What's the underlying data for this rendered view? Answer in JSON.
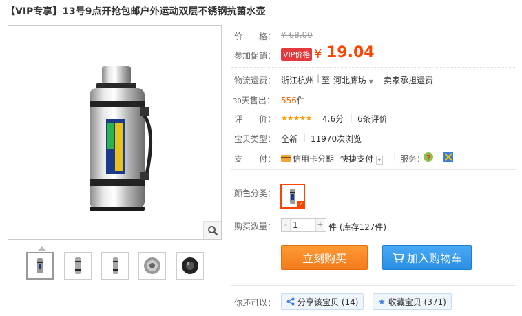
{
  "title": "【VIP专享】13号9点开抢包邮户外运动双层不锈钢抗菌水壶",
  "price": {
    "label": "价　　格：",
    "original": "¥ 68.00"
  },
  "promo": {
    "label": "参加促销：",
    "badge": "VIP价格",
    "yen": "¥",
    "value": "19.04"
  },
  "shipping": {
    "label": "物流运费：",
    "from": "浙江杭州",
    "to_prefix": "至",
    "to": "河北廊坊",
    "fee": "卖家承担运费"
  },
  "sales": {
    "label_num": "30",
    "label_text": "天售出：",
    "count": "556",
    "unit": "件"
  },
  "rating": {
    "label": "评　　价：",
    "stars": "★★★★★",
    "score": "4.6分",
    "count": "6条评价"
  },
  "item_type": {
    "label": "宝贝类型：",
    "condition": "全新",
    "views": "11970次浏览"
  },
  "payment": {
    "label": "支　　付：",
    "credit": "信用卡分期",
    "quick": "快捷支付",
    "service_label": "服务："
  },
  "color": {
    "label": "颜色分类："
  },
  "quantity": {
    "label": "购买数量：",
    "minus": "-",
    "value": "1",
    "plus": "+",
    "stock": "件 (库存127件)"
  },
  "buttons": {
    "buy": "立刻购买",
    "cart": "加入购物车"
  },
  "more": {
    "label": "你还可以：",
    "share": "分享该宝贝 (14)",
    "fav": "收藏宝贝 (371)"
  }
}
